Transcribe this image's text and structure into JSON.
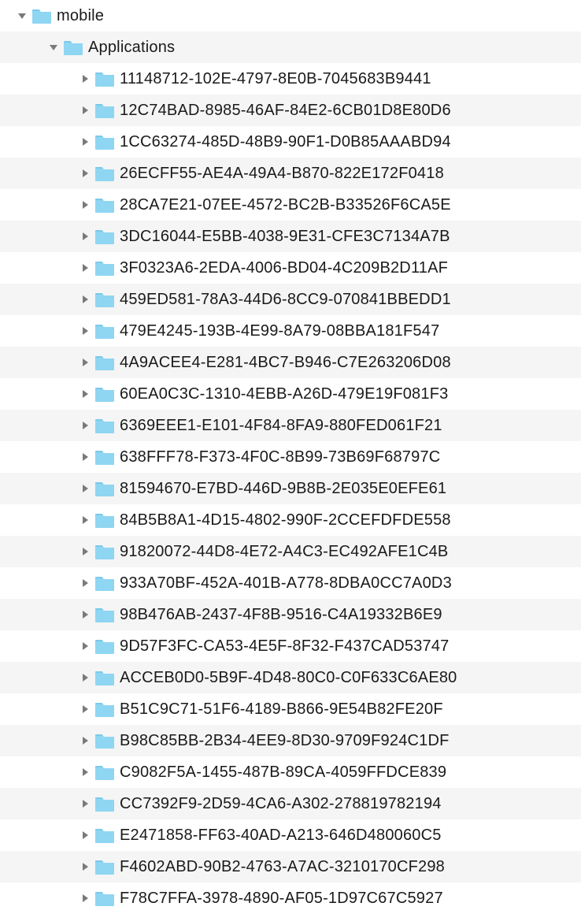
{
  "tree": {
    "root": {
      "label": "mobile",
      "expanded": true,
      "children": [
        {
          "label": "Applications",
          "expanded": true,
          "children": [
            {
              "label": "11148712-102E-4797-8E0B-7045683B9441",
              "expanded": false
            },
            {
              "label": "12C74BAD-8985-46AF-84E2-6CB01D8E80D6",
              "expanded": false
            },
            {
              "label": "1CC63274-485D-48B9-90F1-D0B85AAABD94",
              "expanded": false
            },
            {
              "label": "26ECFF55-AE4A-49A4-B870-822E172F0418",
              "expanded": false
            },
            {
              "label": "28CA7E21-07EE-4572-BC2B-B33526F6CA5E",
              "expanded": false
            },
            {
              "label": "3DC16044-E5BB-4038-9E31-CFE3C7134A7B",
              "expanded": false
            },
            {
              "label": "3F0323A6-2EDA-4006-BD04-4C209B2D11AF",
              "expanded": false
            },
            {
              "label": "459ED581-78A3-44D6-8CC9-070841BBEDD1",
              "expanded": false
            },
            {
              "label": "479E4245-193B-4E99-8A79-08BBA181F547",
              "expanded": false
            },
            {
              "label": "4A9ACEE4-E281-4BC7-B946-C7E263206D08",
              "expanded": false
            },
            {
              "label": "60EA0C3C-1310-4EBB-A26D-479E19F081F3",
              "expanded": false
            },
            {
              "label": "6369EEE1-E101-4F84-8FA9-880FED061F21",
              "expanded": false
            },
            {
              "label": "638FFF78-F373-4F0C-8B99-73B69F68797C",
              "expanded": false
            },
            {
              "label": "81594670-E7BD-446D-9B8B-2E035E0EFE61",
              "expanded": false
            },
            {
              "label": "84B5B8A1-4D15-4802-990F-2CCEFDFDE558",
              "expanded": false
            },
            {
              "label": "91820072-44D8-4E72-A4C3-EC492AFE1C4B",
              "expanded": false
            },
            {
              "label": "933A70BF-452A-401B-A778-8DBA0CC7A0D3",
              "expanded": false
            },
            {
              "label": "98B476AB-2437-4F8B-9516-C4A19332B6E9",
              "expanded": false
            },
            {
              "label": "9D57F3FC-CA53-4E5F-8F32-F437CAD53747",
              "expanded": false
            },
            {
              "label": "ACCEB0D0-5B9F-4D48-80C0-C0F633C6AE80",
              "expanded": false
            },
            {
              "label": "B51C9C71-51F6-4189-B866-9E54B82FE20F",
              "expanded": false
            },
            {
              "label": "B98C85BB-2B34-4EE9-8D30-9709F924C1DF",
              "expanded": false
            },
            {
              "label": "C9082F5A-1455-487B-89CA-4059FFDCE839",
              "expanded": false
            },
            {
              "label": "CC7392F9-2D59-4CA6-A302-278819782194",
              "expanded": false
            },
            {
              "label": "E2471858-FF63-40AD-A213-646D480060C5",
              "expanded": false
            },
            {
              "label": "F4602ABD-90B2-4763-A7AC-3210170CF298",
              "expanded": false
            },
            {
              "label": "F78C7FFA-3978-4890-AF05-1D97C67C5927",
              "expanded": false
            }
          ]
        }
      ]
    }
  },
  "icons": {
    "folder_fill": "#8fd6f2",
    "folder_tab": "#7cc9e8",
    "triangle_fill": "#7a7a7a"
  }
}
